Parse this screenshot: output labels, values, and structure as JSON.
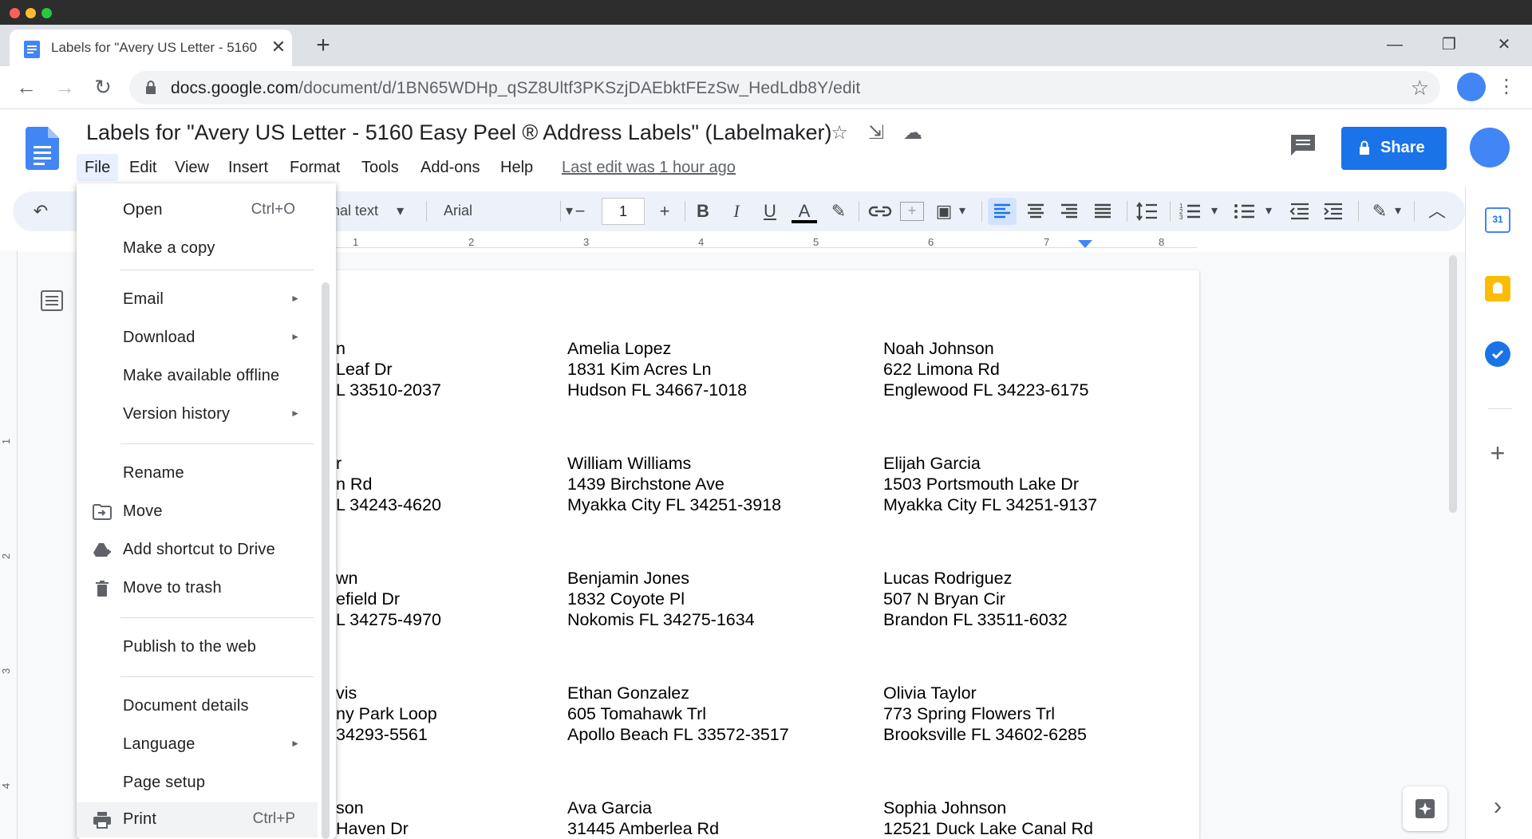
{
  "browser": {
    "tab_title": "Labels for \"Avery US Letter - 5160",
    "tab_close": "✕",
    "new_tab": "+",
    "url_domain": "docs.google.com",
    "url_path": "/document/d/1BN65WDHp_qSZ8Ultf3PKSzjDAEbktFEzSw_HedLdb8Y/edit",
    "minimize": "—",
    "restore": "❐",
    "close": "✕",
    "back": "←",
    "forward": "→",
    "reload": "↻",
    "bookmark_star": "☆",
    "menu_dots": "⋮"
  },
  "doc": {
    "title": "Labels for \"Avery US Letter - 5160 Easy Peel ® Address Labels\" (Labelmaker)",
    "last_edit": "Last edit was 1 hour ago",
    "share_label": "Share",
    "star_icon": "☆",
    "move_icon": "⇲",
    "cloud_icon": "☁"
  },
  "menubar": {
    "items": [
      "File",
      "Edit",
      "View",
      "Insert",
      "Format",
      "Tools",
      "Add-ons",
      "Help"
    ]
  },
  "toolbar": {
    "undo": "↶",
    "style": "nal text",
    "font": "Arial",
    "font_size": "1",
    "minus": "−",
    "plus": "+",
    "bold": "B",
    "italic": "I",
    "underline": "U",
    "text_color": "A",
    "highlight": "✎",
    "link": "🔗",
    "comment": "+",
    "image": "▣",
    "dropdown": "▾",
    "more": "︿",
    "edit_mode": "✎"
  },
  "ruler": {
    "numbers": [
      "1",
      "2",
      "3",
      "4",
      "5",
      "6",
      "7",
      "8"
    ],
    "left_numbers": [
      "1",
      "2",
      "3",
      "4"
    ]
  },
  "labels": [
    {
      "lines": [
        "n",
        " Leaf Dr",
        "L 33510-2037"
      ]
    },
    {
      "lines": [
        "Amelia Lopez",
        "1831 Kim Acres Ln",
        "Hudson FL 34667-1018"
      ]
    },
    {
      "lines": [
        "Noah Johnson",
        "622 Limona Rd",
        "Englewood FL 34223-6175"
      ]
    },
    {
      "lines": [
        "r",
        "n Rd",
        "L 34243-4620"
      ]
    },
    {
      "lines": [
        "William Williams",
        "1439 Birchstone Ave",
        "Myakka City FL 34251-3918"
      ]
    },
    {
      "lines": [
        "Elijah Garcia",
        "1503 Portsmouth Lake Dr",
        "Myakka City FL 34251-9137"
      ]
    },
    {
      "lines": [
        "wn",
        "efield Dr",
        "L 34275-4970"
      ]
    },
    {
      "lines": [
        "Benjamin Jones",
        "1832 Coyote Pl",
        "Nokomis FL 34275-1634"
      ]
    },
    {
      "lines": [
        "Lucas Rodriguez",
        "507 N Bryan Cir",
        "Brandon FL 33511-6032"
      ]
    },
    {
      "lines": [
        "vis",
        "ny Park Loop",
        "34293-5561"
      ]
    },
    {
      "lines": [
        "Ethan Gonzalez",
        "605 Tomahawk Trl",
        "Apollo Beach FL 33572-3517"
      ]
    },
    {
      "lines": [
        "Olivia Taylor",
        "773 Spring Flowers Trl",
        "Brooksville FL 34602-6285"
      ]
    },
    {
      "lines": [
        "son",
        "Haven Dr"
      ]
    },
    {
      "lines": [
        "Ava Garcia",
        "31445 Amberlea Rd"
      ]
    },
    {
      "lines": [
        "Sophia Johnson",
        "12521 Duck Lake Canal Rd"
      ]
    }
  ],
  "file_menu": {
    "open": "Open",
    "open_shortcut": "Ctrl+O",
    "make_copy": "Make a copy",
    "email": "Email",
    "download": "Download",
    "offline": "Make available offline",
    "version_history": "Version history",
    "rename": "Rename",
    "move": "Move",
    "add_shortcut": "Add shortcut to Drive",
    "trash": "Move to trash",
    "publish": "Publish to the web",
    "details": "Document details",
    "language": "Language",
    "page_setup": "Page setup",
    "print": "Print",
    "print_shortcut": "Ctrl+P",
    "submenu_arrow": "►"
  },
  "side_panel": {
    "add": "+",
    "expand": "›",
    "calendar_day": "31"
  }
}
